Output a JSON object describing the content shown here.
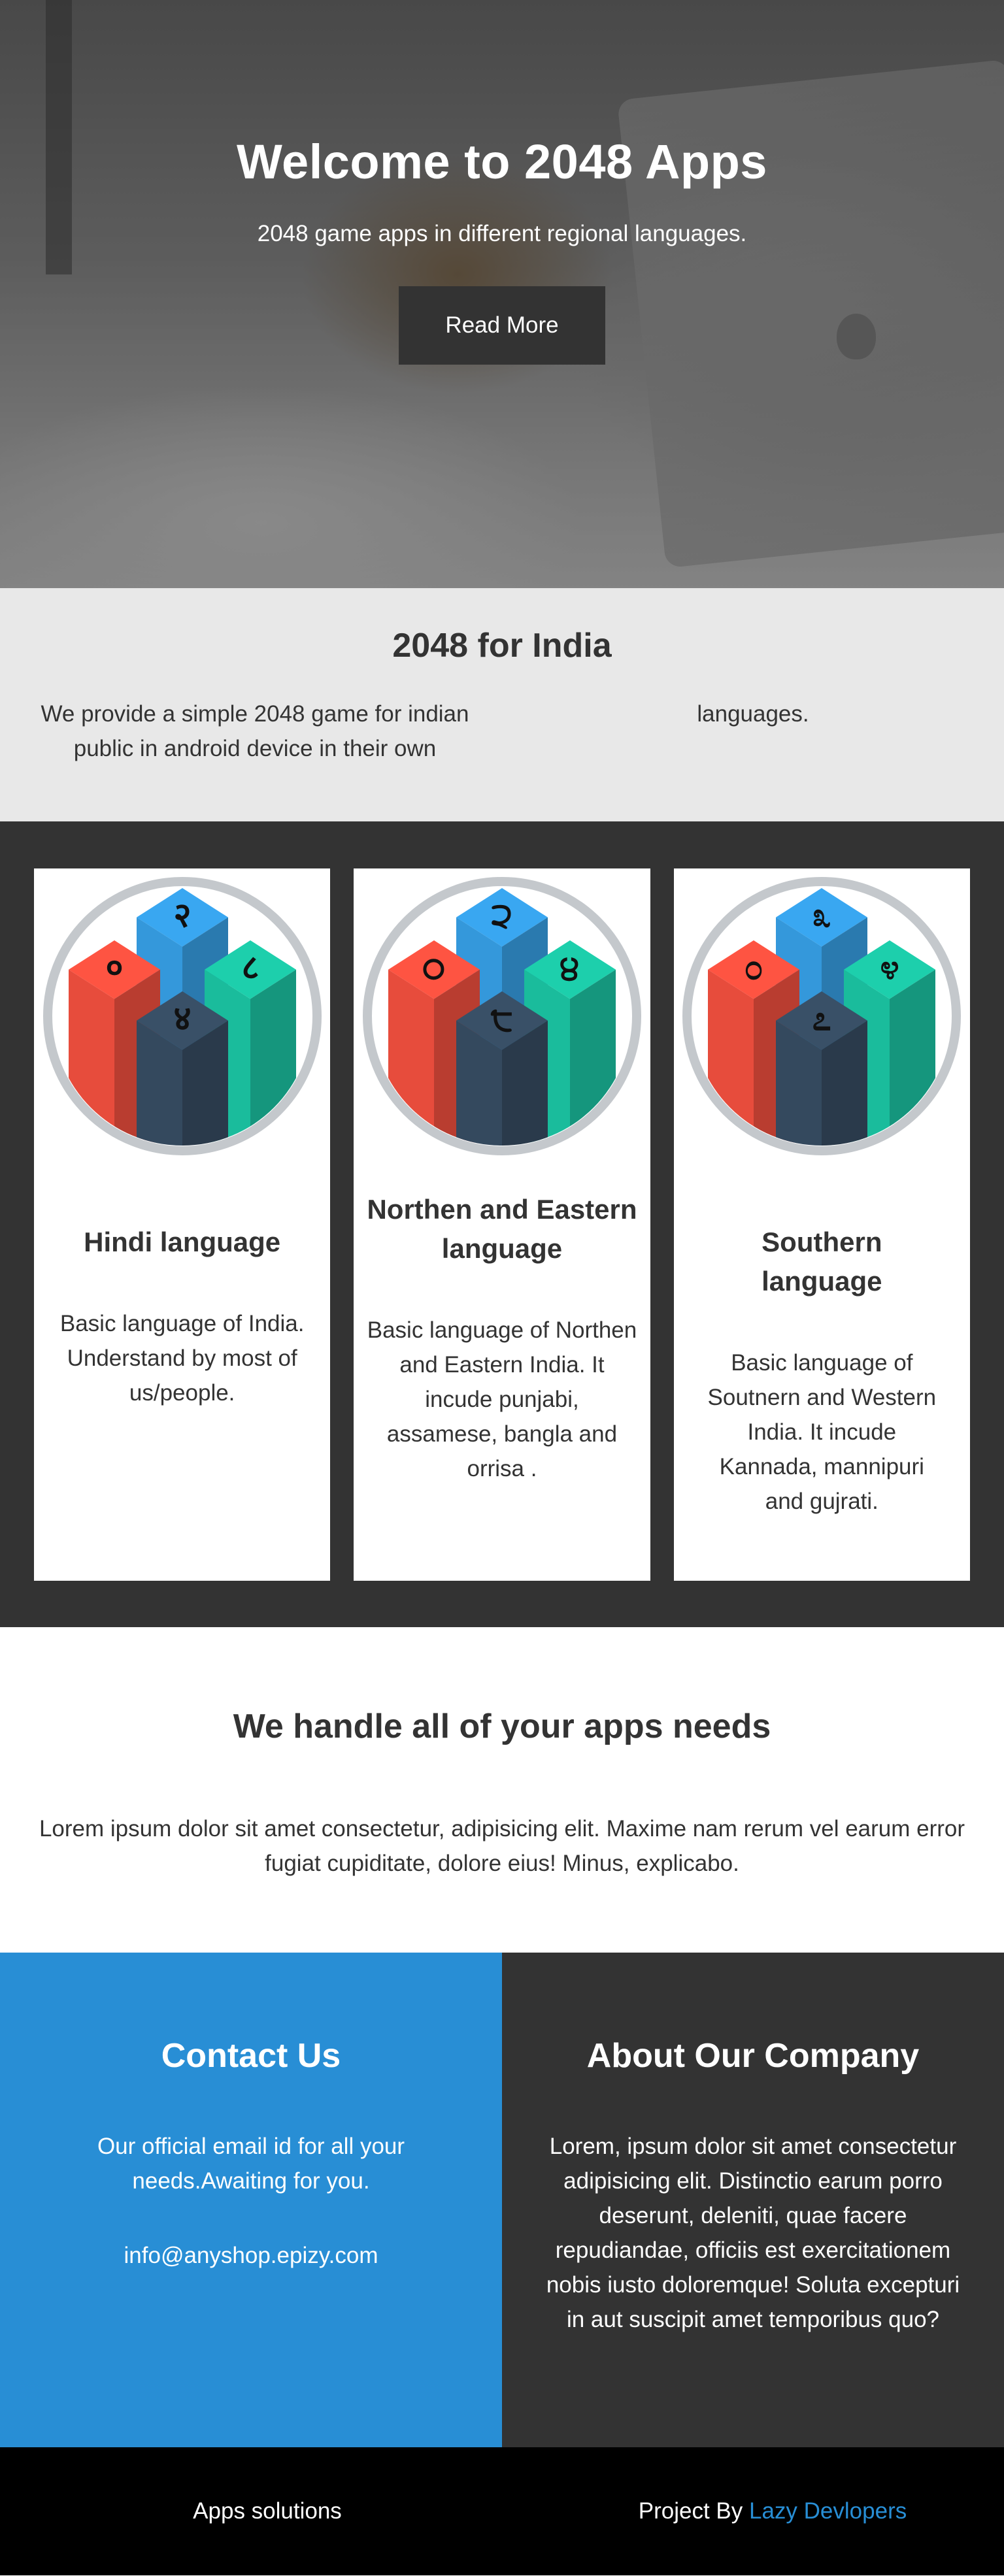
{
  "hero": {
    "title": "Welcome to 2048 Apps",
    "subtitle": "2048 game apps in different regional languages.",
    "button_label": "Read More"
  },
  "india": {
    "title": "2048 for India",
    "left_text": "We provide a simple 2048 game for indian public in android device in their own",
    "right_text": "languages."
  },
  "cards": [
    {
      "title": "Hindi language",
      "text": "Basic language of India. Understand by most of us/people.",
      "glyphs": [
        "२",
        "०",
        "८",
        "४"
      ]
    },
    {
      "title": "Northen and Eastern language",
      "text": "Basic language of Northen and Eastern India. It incude punjabi, assamese, bangla and orrisa .",
      "glyphs": [
        "੨",
        "੦",
        "੪",
        "੮"
      ]
    },
    {
      "title": "Southern language",
      "text": "Basic language of Soutnern and Western India. It incude Kannada, mannipuri and gujrati.",
      "glyphs": [
        "೩",
        "೦",
        "೪",
        "೭"
      ]
    }
  ],
  "needs": {
    "title": "We handle all of your apps needs",
    "text": "Lorem ipsum dolor sit amet consectetur, adipisicing elit. Maxime nam rerum vel earum error fugiat cupiditate, dolore eius! Minus, explicabo."
  },
  "contact": {
    "title": "Contact Us",
    "text": "Our official email id for all your needs.Awaiting for you.",
    "email": "info@anyshop.epizy.com"
  },
  "about": {
    "title": "About Our Company",
    "text": "Lorem, ipsum dolor sit amet consectetur adipisicing elit. Distinctio earum porro deserunt, deleniti, quae facere repudiandae, officiis est exercitationem nobis iusto doloremque! Soluta excepturi in aut suscipit amet temporibus quo?"
  },
  "footer": {
    "left": "Apps solutions",
    "right_prefix": "Project By",
    "right_link": "Lazy Devlopers"
  },
  "colors": {
    "accent": "#288ed5",
    "dark": "#333333",
    "light": "#e8e8e8",
    "footer": "#000000",
    "cube_red": "#e74c3c",
    "cube_blue": "#3498db",
    "cube_teal": "#1abc9c",
    "cube_navy": "#34495e"
  }
}
